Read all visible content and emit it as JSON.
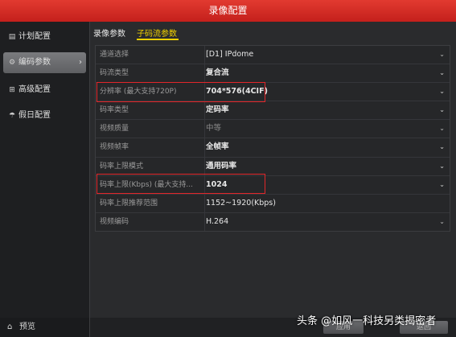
{
  "window": {
    "title": "录像配置"
  },
  "sidebar": {
    "items": [
      {
        "label": "计划配置",
        "icon": "calendar-icon"
      },
      {
        "label": "编码参数",
        "icon": "settings-icon",
        "active": true
      },
      {
        "label": "高级配置",
        "icon": "advanced-icon"
      },
      {
        "label": "假日配置",
        "icon": "holiday-icon"
      }
    ],
    "preview_label": "预览"
  },
  "tabs": [
    {
      "label": "录像参数"
    },
    {
      "label": "子码流参数",
      "active": true
    }
  ],
  "settings": {
    "rows": [
      {
        "label": "通道选择",
        "value": "[D1] IPdome"
      },
      {
        "label": "码流类型",
        "value": "复合流"
      },
      {
        "label": "分辨率 (最大支持720P)",
        "value": "704*576(4CIF)"
      },
      {
        "label": "码率类型",
        "value": "定码率"
      },
      {
        "label": "视频质量",
        "value": "中等"
      },
      {
        "label": "视频帧率",
        "value": "全帧率"
      },
      {
        "label": "码率上限模式",
        "value": "通用码率"
      },
      {
        "label": "码率上限(Kbps) (最大支持...",
        "value": "1024"
      },
      {
        "label": "码率上限推荐范围",
        "value": "1152~1920(Kbps)"
      },
      {
        "label": "视频编码",
        "value": "H.264"
      }
    ]
  },
  "footer": {
    "apply_label": "应用",
    "back_label": "返回"
  },
  "watermark": "头条 @如风一科技另类揭密者",
  "colors": {
    "title_bar": "#d2281f",
    "active_tab": "#f0d000",
    "highlight": "#e2262a"
  }
}
